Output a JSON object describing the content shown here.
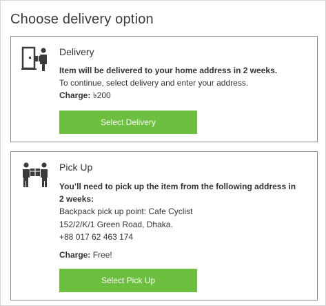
{
  "page": {
    "title": "Choose delivery option"
  },
  "delivery": {
    "title": "Delivery",
    "line1": "Item will be delivered to your home address in 2 weeks.",
    "line2": "To continue, select delivery and enter your address.",
    "charge_label": "Charge:",
    "charge_value": "৳200",
    "button_label": "Select Delivery",
    "icon": "delivery-door-icon"
  },
  "pickup": {
    "title": "Pick Up",
    "line1": "You’ll need to pick up the item from the following address in",
    "line2": "2 weeks:",
    "address_line1": "Backpack pick up point: Cafe Cyclist",
    "address_line2": "152/2/K/1 Green Road, Dhaka.",
    "phone": "+88 017 62 463 174",
    "charge_label": "Charge:",
    "charge_value": "Free!",
    "button_label": "Select Pick Up",
    "icon": "handover-icon"
  },
  "colors": {
    "button": "#6cbf3f",
    "border": "#8a8a8a",
    "text": "#333333"
  }
}
